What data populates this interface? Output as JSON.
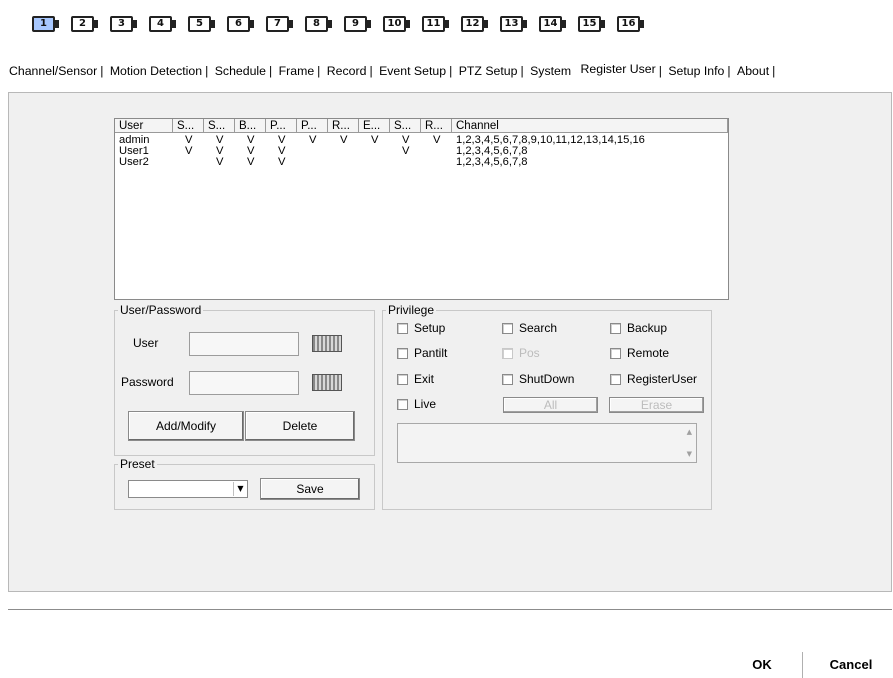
{
  "channels": [
    "1",
    "2",
    "3",
    "4",
    "5",
    "6",
    "7",
    "8",
    "9",
    "10",
    "11",
    "12",
    "13",
    "14",
    "15",
    "16"
  ],
  "active_channel": "1",
  "tabs": [
    "Channel/Sensor",
    "Motion Detection",
    "Schedule",
    "Frame",
    "Record",
    "Event Setup",
    "PTZ Setup",
    "System",
    "Register User",
    "Setup Info",
    "About"
  ],
  "active_tab": "Register User",
  "user_list": {
    "columns": [
      "User",
      "S...",
      "S...",
      "B...",
      "P...",
      "P...",
      "R...",
      "E...",
      "S...",
      "R...",
      "Channel"
    ],
    "rows": [
      {
        "user": "admin",
        "flags": [
          "V",
          "V",
          "V",
          "V",
          "V",
          "V",
          "V",
          "V",
          "V"
        ],
        "channel": "1,2,3,4,5,6,7,8,9,10,11,12,13,14,15,16"
      },
      {
        "user": "User1",
        "flags": [
          "V",
          "V",
          "V",
          "V",
          "",
          "",
          "",
          "V",
          ""
        ],
        "channel": "1,2,3,4,5,6,7,8"
      },
      {
        "user": "User2",
        "flags": [
          "",
          "V",
          "V",
          "V",
          "",
          "",
          "",
          "",
          ""
        ],
        "channel": "1,2,3,4,5,6,7,8"
      }
    ]
  },
  "user_password": {
    "title": "User/Password",
    "user_label": "User",
    "user_value": "",
    "password_label": "Password",
    "password_value": "",
    "add_modify": "Add/Modify",
    "delete": "Delete"
  },
  "preset": {
    "title": "Preset",
    "selected": "",
    "save": "Save"
  },
  "privilege": {
    "title": "Privilege",
    "items": [
      {
        "label": "Setup",
        "checked": false,
        "enabled": true
      },
      {
        "label": "Search",
        "checked": false,
        "enabled": true
      },
      {
        "label": "Backup",
        "checked": false,
        "enabled": true
      },
      {
        "label": "Pantilt",
        "checked": false,
        "enabled": true
      },
      {
        "label": "Pos",
        "checked": false,
        "enabled": false
      },
      {
        "label": "Remote",
        "checked": false,
        "enabled": true
      },
      {
        "label": "Exit",
        "checked": false,
        "enabled": true
      },
      {
        "label": "ShutDown",
        "checked": false,
        "enabled": true
      },
      {
        "label": "RegisterUser",
        "checked": false,
        "enabled": true
      },
      {
        "label": "Live",
        "checked": false,
        "enabled": true
      }
    ],
    "all": "All",
    "erase": "Erase",
    "notes": ""
  },
  "footer": {
    "ok": "OK",
    "cancel": "Cancel"
  }
}
